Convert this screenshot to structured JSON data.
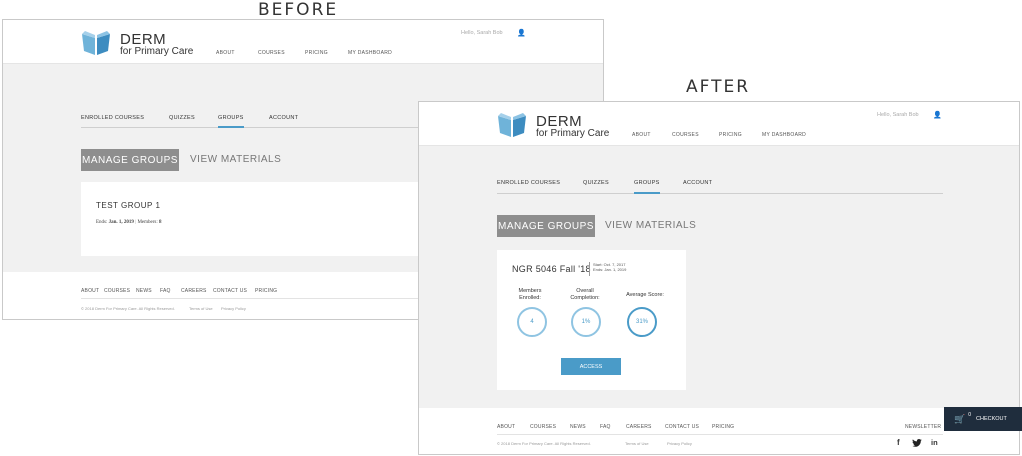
{
  "captions": {
    "before": "BEFORE",
    "after": "AFTER"
  },
  "brand": {
    "line1": "DERM",
    "line2": "for Primary Care"
  },
  "nav": [
    "ABOUT",
    "COURSES",
    "PRICING",
    "MY DASHBOARD"
  ],
  "greeting": "Hello, Sarah Bob",
  "tabs": [
    "ENROLLED COURSES",
    "QUIZZES",
    "GROUPS",
    "ACCOUNT"
  ],
  "active_tab": "GROUPS",
  "buttons": {
    "manage": "MANAGE GROUPS",
    "view": "VIEW MATERIALS",
    "access": "ACCESS"
  },
  "before_group": {
    "name": "TEST GROUP 1",
    "ends_label": "Ends:",
    "ends_value": "Jan. 1, 2019",
    "separator": "|",
    "members_label": "Members:",
    "members_value": "8"
  },
  "after_group": {
    "name": "NGR 5046 Fall '18",
    "start": "Start: Oct. 7, 2017",
    "end": "Ends: Jan. 1, 2019",
    "stats": [
      {
        "label_line1": "Members",
        "label_line2": "Enrolled:",
        "value": "4"
      },
      {
        "label_line1": "Overall",
        "label_line2": "Completion:",
        "value": "1%"
      },
      {
        "label_line1": "Average Score:",
        "label_line2": "",
        "value": "31%"
      }
    ]
  },
  "footer": {
    "nav": [
      "ABOUT",
      "COURSES",
      "NEWS",
      "FAQ",
      "CAREERS",
      "CONTACT US",
      "PRICING"
    ],
    "copyright": "© 2018 Derm For Primary Care. All Rights Reserved.",
    "terms": "Terms of Use",
    "privacy": "Privacy Policy",
    "newsletter": "NEWSLETTER",
    "social": [
      "f",
      "twitter",
      "in"
    ]
  },
  "checkout": {
    "count": "0",
    "label": "CHECKOUT"
  },
  "colors": {
    "accent": "#4a9bc8",
    "manage_bg": "#8e8e8e",
    "checkout_bg": "#1f2d3d"
  }
}
